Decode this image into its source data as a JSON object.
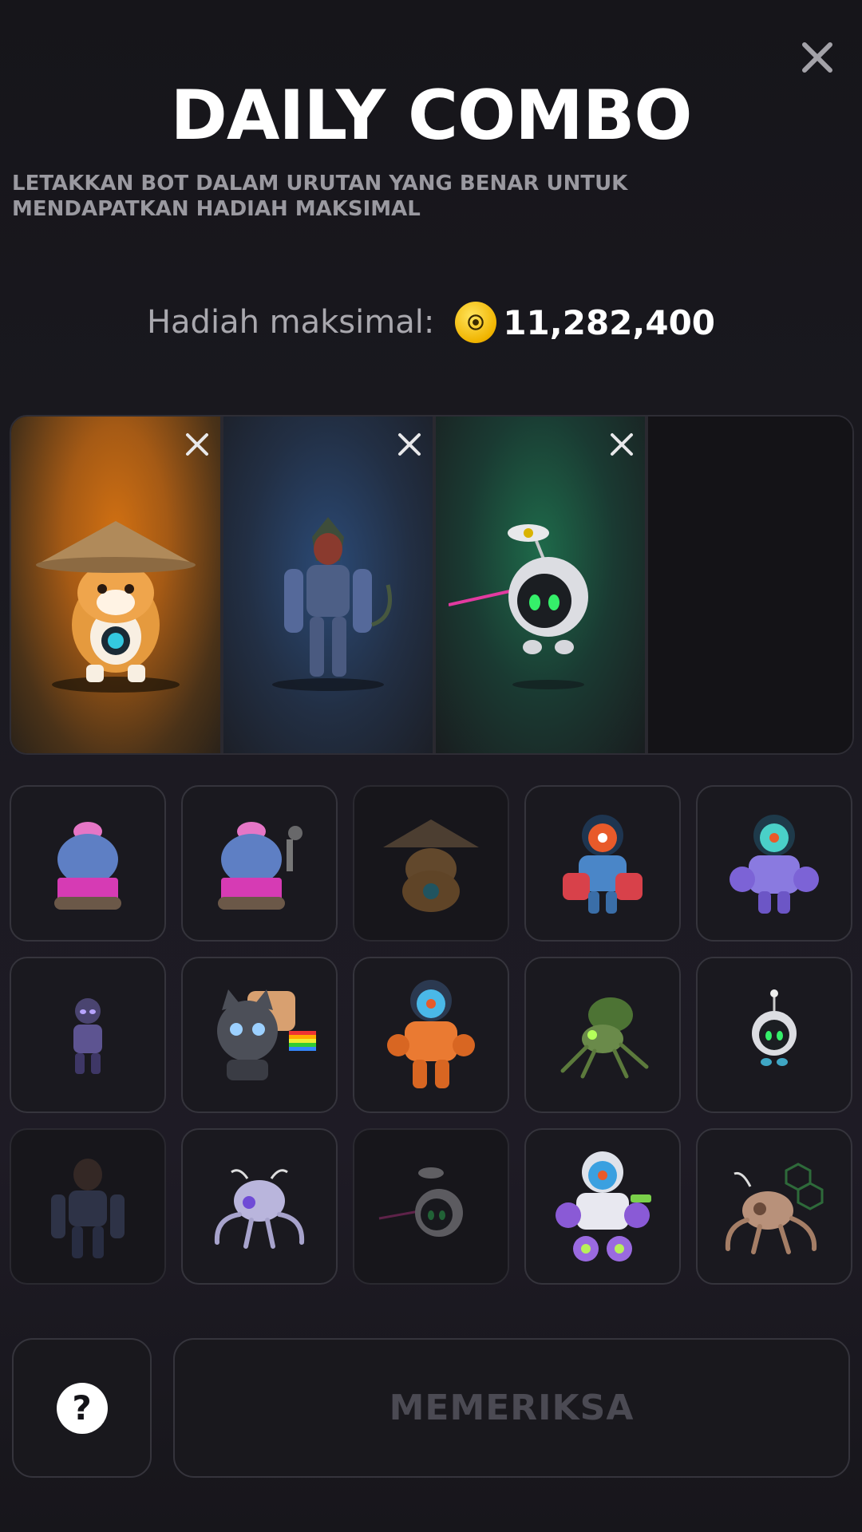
{
  "header": {
    "title": "DAILY COMBO",
    "subtitle_line1": "LETAKKAN BOT DALAM URUTAN YANG BENAR UNTUK",
    "subtitle_line2": "MENDAPATKAN HADIAH MAKSIMAL",
    "close_icon": "close-icon"
  },
  "reward": {
    "label": "Hadiah maksimal:",
    "value": "11,282,400",
    "coin_icon": "coin-icon",
    "coin_color": "#f5c400"
  },
  "slots": [
    {
      "bot": "shiba-straw-hat-bot",
      "filled": true,
      "accent": "#d17012"
    },
    {
      "bot": "werewolf-mech-bot",
      "filled": true,
      "accent": "#2b4a76"
    },
    {
      "bot": "nuke-orb-bot",
      "filled": true,
      "accent": "#1e6a4a"
    },
    {
      "bot": "",
      "filled": false
    }
  ],
  "bots": [
    {
      "name": "cactus-tank-bot",
      "used": false
    },
    {
      "name": "cactus-tank-smoke-bot",
      "used": false
    },
    {
      "name": "shiba-straw-hat-bot",
      "used": true
    },
    {
      "name": "astronaut-red-mech-bot",
      "used": false
    },
    {
      "name": "astronaut-purple-mech-bot",
      "used": false
    },
    {
      "name": "panther-mech-bot",
      "used": false
    },
    {
      "name": "nyan-cat-bot",
      "used": false
    },
    {
      "name": "astronaut-orange-mech-bot",
      "used": false
    },
    {
      "name": "mantis-spider-bot",
      "used": false
    },
    {
      "name": "orb-antenna-bot",
      "used": false
    },
    {
      "name": "werewolf-mech-bot",
      "used": true
    },
    {
      "name": "spider-drone-bot",
      "used": false
    },
    {
      "name": "nuke-orb-bot",
      "used": true
    },
    {
      "name": "space-ranger-mech-bot",
      "used": false
    },
    {
      "name": "hex-spider-bot",
      "used": false
    }
  ],
  "footer": {
    "help_label": "?",
    "check_label": "MEMERIKSA"
  }
}
